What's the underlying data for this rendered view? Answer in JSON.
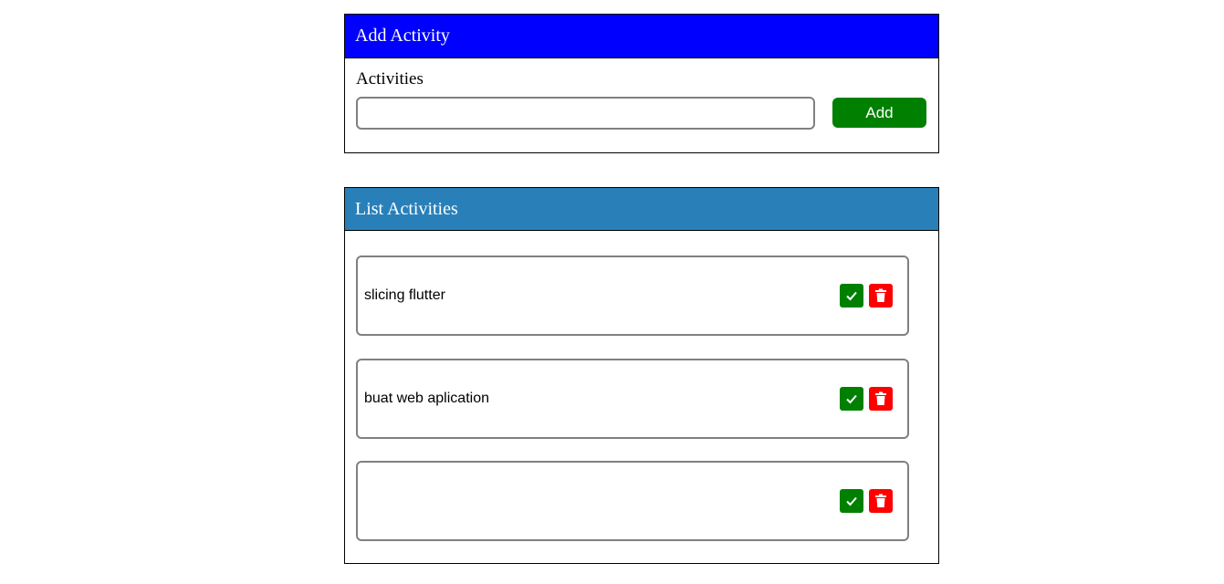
{
  "colors": {
    "add_header_bg": "#0000ff",
    "list_header_bg": "#2980b9",
    "add_button_bg": "#008000",
    "done_button_bg": "#008000",
    "delete_button_bg": "#ff0000"
  },
  "add_panel": {
    "title": "Add Activity",
    "field_label": "Activities",
    "input_value": "",
    "input_placeholder": "",
    "add_button_label": "Add"
  },
  "list_panel": {
    "title": "List Activities",
    "items": [
      {
        "text": "slicing flutter",
        "done_icon": "check-icon",
        "delete_icon": "trash-icon"
      },
      {
        "text": "buat web aplication",
        "done_icon": "check-icon",
        "delete_icon": "trash-icon"
      },
      {
        "text": "",
        "done_icon": "check-icon",
        "delete_icon": "trash-icon"
      }
    ]
  }
}
